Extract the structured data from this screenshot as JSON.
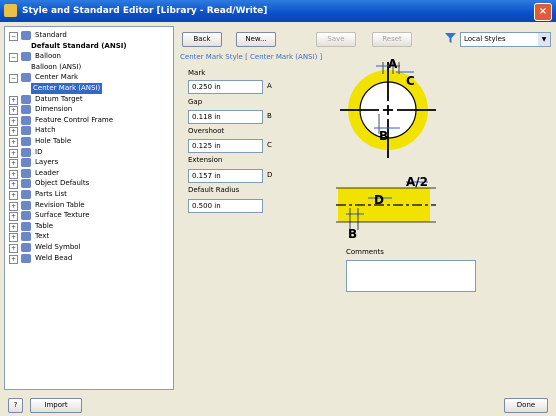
{
  "window": {
    "title": "Style and Standard Editor [Library - Read/Write]",
    "close_label": "×"
  },
  "tree": {
    "items": [
      {
        "label": "Standard",
        "expander": "−",
        "icon": "standard-icon"
      },
      {
        "label": "Default Standard (ANSI)",
        "icon": "none"
      },
      {
        "label": "Balloon",
        "expander": "−",
        "icon": "balloon-icon"
      },
      {
        "label": "Balloon (ANSI)",
        "icon": "none"
      },
      {
        "label": "Center Mark",
        "expander": "−",
        "icon": "center-mark-icon"
      },
      {
        "label": "Center Mark (ANSI)",
        "icon": "none",
        "selected": true
      },
      {
        "label": "Datum Target",
        "expander": "+",
        "icon": "datum-target-icon"
      },
      {
        "label": "Dimension",
        "expander": "+",
        "icon": "dimension-icon"
      },
      {
        "label": "Feature Control Frame",
        "expander": "+",
        "icon": "feature-control-frame-icon"
      },
      {
        "label": "Hatch",
        "expander": "+",
        "icon": "hatch-icon"
      },
      {
        "label": "Hole Table",
        "expander": "+",
        "icon": "hole-table-icon"
      },
      {
        "label": "ID",
        "expander": "+",
        "icon": "id-icon"
      },
      {
        "label": "Layers",
        "expander": "+",
        "icon": "layers-icon"
      },
      {
        "label": "Leader",
        "expander": "+",
        "icon": "leader-icon"
      },
      {
        "label": "Object Defaults",
        "expander": "+",
        "icon": "object-defaults-icon"
      },
      {
        "label": "Parts List",
        "expander": "+",
        "icon": "parts-list-icon"
      },
      {
        "label": "Revision Table",
        "expander": "+",
        "icon": "revision-table-icon"
      },
      {
        "label": "Surface Texture",
        "expander": "+",
        "icon": "surface-texture-icon"
      },
      {
        "label": "Table",
        "expander": "+",
        "icon": "table-icon"
      },
      {
        "label": "Text",
        "expander": "+",
        "icon": "text-icon"
      },
      {
        "label": "Weld Symbol",
        "expander": "+",
        "icon": "weld-symbol-icon"
      },
      {
        "label": "Weld Bead",
        "expander": "+",
        "icon": "weld-bead-icon"
      }
    ]
  },
  "toolbar": {
    "back_label": "Back",
    "new_label": "New...",
    "save_label": "Save",
    "reset_label": "Reset",
    "filter_value": "Local Styles"
  },
  "style_path": "Center Mark Style [ Center Mark (ANSI) ]",
  "fields": [
    {
      "label": "Mark",
      "value": "0.250 in",
      "letter": "A"
    },
    {
      "label": "Gap",
      "value": "0.118 in",
      "letter": "B"
    },
    {
      "label": "Overshoot",
      "value": "0.125 in",
      "letter": "C"
    },
    {
      "label": "Extension",
      "value": "0.157 in",
      "letter": "D"
    },
    {
      "label": "Default Radius",
      "value": "0.500 in",
      "letter": ""
    }
  ],
  "diagram": {
    "labels": [
      "A",
      "B",
      "C",
      "A/2",
      "D",
      "B"
    ],
    "accent": "#f2e200"
  },
  "comments": {
    "label": "Comments"
  },
  "bottom": {
    "import_label": "Import",
    "done_label": "Done"
  }
}
